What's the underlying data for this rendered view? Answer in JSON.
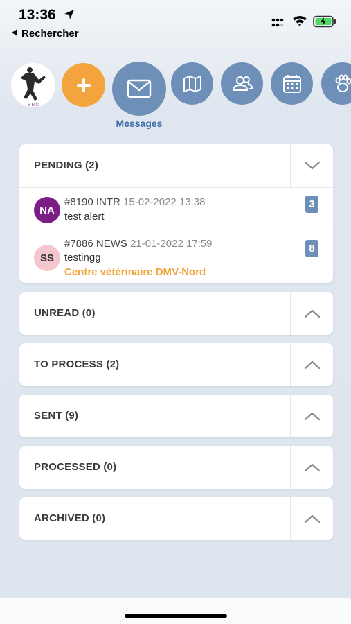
{
  "status": {
    "time": "13:36",
    "back_label": "Rechercher"
  },
  "nav": {
    "items": [
      {
        "name": "add",
        "icon": "plus-icon"
      },
      {
        "name": "messages",
        "icon": "envelope-icon",
        "label": "Messages"
      },
      {
        "name": "map",
        "icon": "map-icon"
      },
      {
        "name": "users",
        "icon": "users-icon"
      },
      {
        "name": "calendar",
        "icon": "calendar-icon"
      },
      {
        "name": "animals",
        "icon": "paw-icon"
      }
    ],
    "active_label": "Messages"
  },
  "sections": {
    "pending": {
      "title": "PENDING (2)",
      "expanded": true,
      "messages": [
        {
          "initials": "NA",
          "avatar_color": "#7b1f87",
          "avatar_text_color": "#ffffff",
          "id_type": "#8190 INTR",
          "date": "15-02-2022 13:38",
          "text": "test alert",
          "count": "3"
        },
        {
          "initials": "SS",
          "avatar_color": "#f6c6cf",
          "avatar_text_color": "#333333",
          "id_type": "#7886 NEWS",
          "date": "21-01-2022 17:59",
          "text": "testingg",
          "org": "Centre vétérinaire DMV-Nord",
          "count": "8"
        }
      ]
    },
    "unread": {
      "title": "UNREAD (0)"
    },
    "to_process": {
      "title": "TO PROCESS (2)"
    },
    "sent": {
      "title": "SENT (9)"
    },
    "processed": {
      "title": "PROCESSED (0)"
    },
    "archived": {
      "title": "ARCHIVED (0)"
    }
  },
  "colors": {
    "accent_orange": "#f3a43c",
    "nav_blue": "#6e8fb7",
    "label_blue": "#3d6ea8"
  }
}
